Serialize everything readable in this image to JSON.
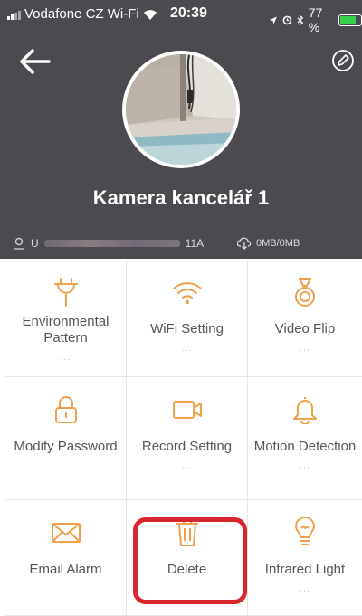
{
  "status_bar": {
    "carrier": "Vodafone CZ Wi-Fi",
    "time": "20:39",
    "battery_percent": "77 %",
    "battery_level": 0.77
  },
  "header": {
    "camera_name": "Kamera kancelář 1",
    "uid_suffix": "11A",
    "storage": "0MB/0MB"
  },
  "colors": {
    "accent": "#f0a04b",
    "header_bg": "#4b4a4e",
    "highlight": "#d8262c"
  },
  "settings": [
    {
      "label": "Environmental Pattern",
      "sub": "...",
      "icon": "plug-icon"
    },
    {
      "label": "WiFi Setting",
      "sub": "...",
      "icon": "wifi-icon"
    },
    {
      "label": "Video Flip",
      "sub": "...",
      "icon": "flip-icon"
    },
    {
      "label": "Modify Password",
      "sub": "",
      "icon": "lock-icon"
    },
    {
      "label": "Record Setting",
      "sub": "...",
      "icon": "video-camera-icon"
    },
    {
      "label": "Motion Detection",
      "sub": "...",
      "icon": "bell-icon"
    },
    {
      "label": "Email Alarm",
      "sub": "",
      "icon": "envelope-icon"
    },
    {
      "label": "Delete",
      "sub": "",
      "icon": "trash-icon"
    },
    {
      "label": "Infrared Light",
      "sub": "...",
      "icon": "lightbulb-icon"
    }
  ]
}
